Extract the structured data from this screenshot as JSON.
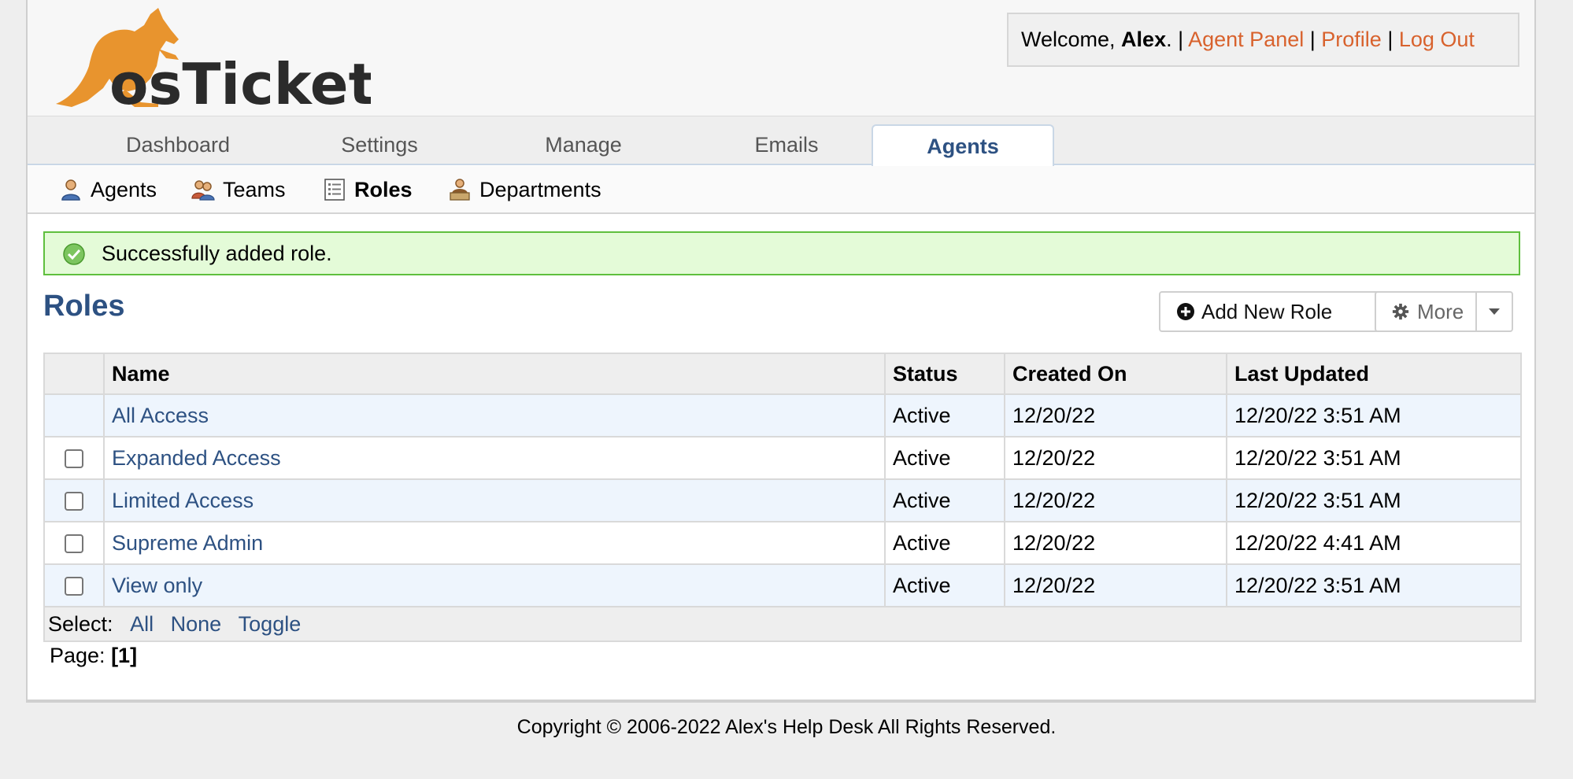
{
  "header": {
    "logo_text": "osTicket",
    "welcome_prefix": "Welcome, ",
    "user_name": "Alex",
    "welcome_suffix": ". | ",
    "links": [
      "Agent Panel",
      "Profile",
      "Log Out"
    ],
    "separator": " | "
  },
  "nav": {
    "tabs": [
      "Dashboard",
      "Settings",
      "Manage",
      "Emails",
      "Agents"
    ],
    "active": "Agents"
  },
  "subnav": {
    "items": [
      "Agents",
      "Teams",
      "Roles",
      "Departments"
    ],
    "active": "Roles"
  },
  "notice": {
    "message": "Successfully added role."
  },
  "page": {
    "title": "Roles",
    "add_button": "Add New Role",
    "more_button": "More"
  },
  "table": {
    "headers": [
      "Name",
      "Status",
      "Created On",
      "Last Updated"
    ],
    "rows": [
      {
        "name": "All Access",
        "status": "Active",
        "created": "12/20/22",
        "updated": "12/20/22 3:51 AM"
      },
      {
        "name": "Expanded Access",
        "status": "Active",
        "created": "12/20/22",
        "updated": "12/20/22 3:51 AM"
      },
      {
        "name": "Limited Access",
        "status": "Active",
        "created": "12/20/22",
        "updated": "12/20/22 3:51 AM"
      },
      {
        "name": "Supreme Admin",
        "status": "Active",
        "created": "12/20/22",
        "updated": "12/20/22 4:41 AM"
      },
      {
        "name": "View only",
        "status": "Active",
        "created": "12/20/22",
        "updated": "12/20/22 3:51 AM"
      }
    ],
    "select_label": "Select:",
    "select_links": [
      "All",
      "None",
      "Toggle"
    ]
  },
  "pager": {
    "label": "Page: ",
    "current": "[1]"
  },
  "footer": {
    "text": "Copyright © 2006-2022 Alex's Help Desk All Rights Reserved."
  },
  "colors": {
    "accent": "#2d5182",
    "link_orange": "#d8622d",
    "success_bg": "#e4fbd8",
    "success_border": "#5fbf3e"
  }
}
